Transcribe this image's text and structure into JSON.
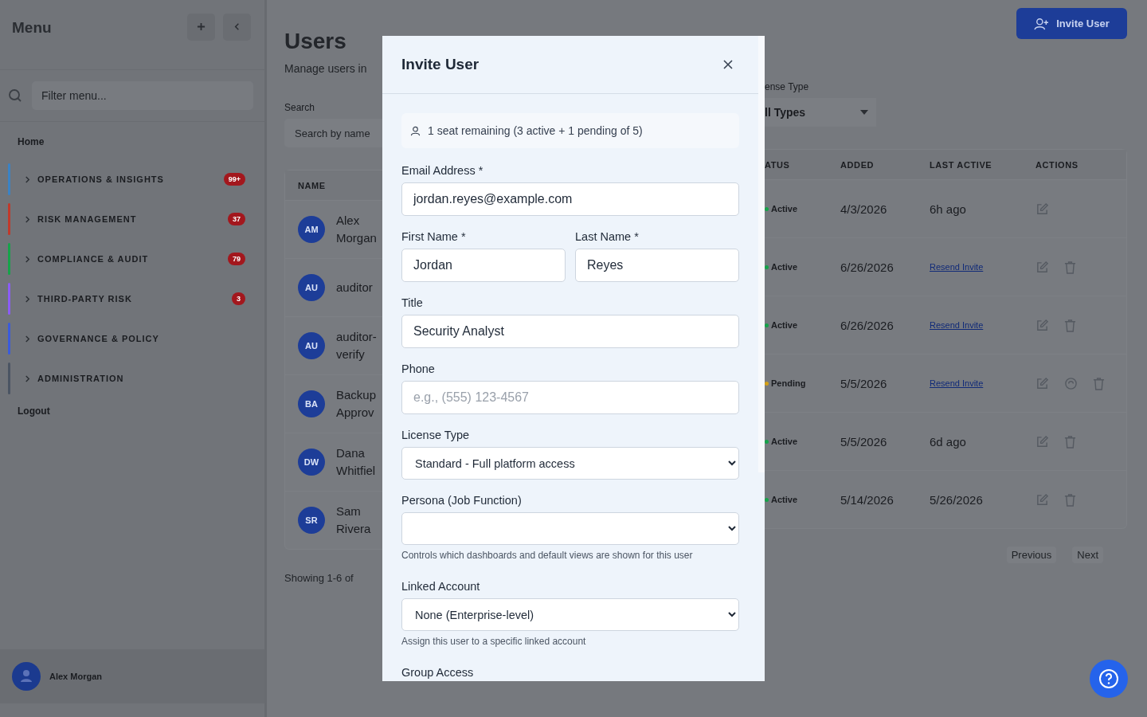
{
  "sidebar": {
    "title": "Menu",
    "filter_placeholder": "Filter menu...",
    "home": "Home",
    "sections": [
      {
        "label": "OPERATIONS & INSIGHTS",
        "color": "#3b82c4",
        "badge": "99+"
      },
      {
        "label": "RISK MANAGEMENT",
        "color": "#c0392b",
        "badge": "37"
      },
      {
        "label": "COMPLIANCE & AUDIT",
        "color": "#16a34a",
        "badge": "79"
      },
      {
        "label": "THIRD-PARTY RISK",
        "color": "#8b5cf6",
        "badge": "3"
      },
      {
        "label": "GOVERNANCE & POLICY",
        "color": "#3b5bdb"
      },
      {
        "label": "ADMINISTRATION",
        "color": "#4b5563"
      }
    ],
    "logout": "Logout",
    "user_name": "Alex Morgan"
  },
  "page": {
    "title": "Users",
    "subtitle": "Manage users in",
    "search_label": "Search",
    "search_placeholder": "Search by name",
    "license_label": "ense Type",
    "license_value": "ll Types",
    "invite_button": "Invite User"
  },
  "table": {
    "name_column": "NAME",
    "columns": [
      "ATUS",
      "ADDED",
      "LAST ACTIVE",
      "ACTIONS"
    ],
    "rows": [
      {
        "initials": "AM",
        "name": "Alex Morgan",
        "status": {
          "kind": "active",
          "label": "Active"
        },
        "added": "4/3/2026",
        "last_active": {
          "kind": "text",
          "text": "6h ago"
        },
        "actions": [
          {
            "kind": "edit"
          }
        ]
      },
      {
        "initials": "AU",
        "name": "auditor",
        "status": {
          "kind": "active",
          "label": "Active"
        },
        "added": "6/26/2026",
        "last_active": {
          "kind": "link",
          "text": "Resend Invite"
        },
        "actions": [
          {
            "kind": "edit"
          },
          {
            "kind": "delete"
          }
        ]
      },
      {
        "initials": "AU",
        "name": "auditor-verify",
        "status": {
          "kind": "active",
          "label": "Active"
        },
        "added": "6/26/2026",
        "last_active": {
          "kind": "link",
          "text": "Resend Invite"
        },
        "actions": [
          {
            "kind": "edit"
          },
          {
            "kind": "delete"
          }
        ]
      },
      {
        "initials": "BA",
        "name": "Backup Approv",
        "status": {
          "kind": "pending",
          "label": "Pending"
        },
        "added": "5/5/2026",
        "last_active": {
          "kind": "link",
          "text": "Resend Invite"
        },
        "actions": [
          {
            "kind": "edit"
          },
          {
            "kind": "resend"
          },
          {
            "kind": "delete"
          }
        ]
      },
      {
        "initials": "DW",
        "name": "Dana Whitfiel",
        "status": {
          "kind": "active",
          "label": "Active"
        },
        "added": "5/5/2026",
        "last_active": {
          "kind": "text",
          "text": "6d ago"
        },
        "actions": [
          {
            "kind": "edit"
          },
          {
            "kind": "delete"
          }
        ]
      },
      {
        "initials": "SR",
        "name": "Sam Rivera",
        "status": {
          "kind": "active",
          "label": "Active"
        },
        "added": "5/14/2026",
        "last_active": {
          "kind": "text",
          "text": "5/26/2026"
        },
        "actions": [
          {
            "kind": "edit"
          },
          {
            "kind": "delete"
          }
        ]
      }
    ],
    "footer": "Showing 1-6 of",
    "previous": "Previous",
    "next": "Next"
  },
  "modal": {
    "title": "Invite User",
    "seats": "1 seat remaining (3 active + 1 pending of 5)",
    "fields": [
      {
        "kind": "text",
        "label": "Email Address *",
        "value": "jordan.reyes@example.com"
      },
      {
        "kind": "pair",
        "items": [
          {
            "label": "First Name *",
            "value": "Jordan"
          },
          {
            "label": "Last Name *",
            "value": "Reyes"
          }
        ]
      },
      {
        "kind": "text",
        "label": "Title",
        "value": "Security Analyst"
      },
      {
        "kind": "text",
        "label": "Phone",
        "placeholder": "e.g., (555) 123-4567"
      },
      {
        "kind": "select",
        "label": "License Type",
        "value": "Standard - Full platform access"
      },
      {
        "kind": "select",
        "label": "Persona (Job Function)",
        "hint": "Controls which dashboards and default views are shown for this user"
      },
      {
        "kind": "select",
        "label": "Linked Account",
        "value": "None (Enterprise-level)",
        "hint": "Assign this user to a specific linked account"
      },
      {
        "kind": "heading",
        "label": "Group Access"
      }
    ]
  }
}
